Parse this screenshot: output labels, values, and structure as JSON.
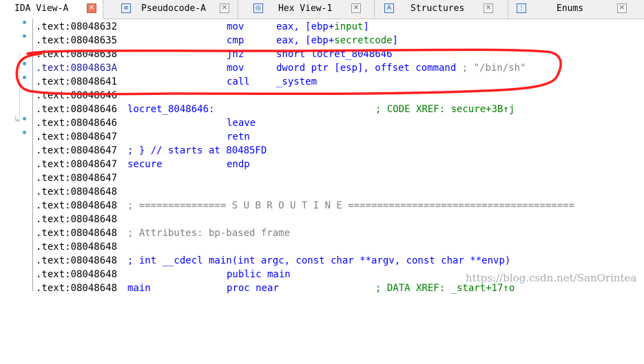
{
  "tabs": [
    {
      "label": "IDA View-A",
      "icon": "none",
      "active": true
    },
    {
      "label": "Pseudocode-A",
      "icon": "pseudocode-icon",
      "active": false
    },
    {
      "label": "Hex View-1",
      "icon": "hex-icon",
      "active": false
    },
    {
      "label": "Structures",
      "icon": "structures-icon",
      "active": false
    },
    {
      "label": "Enums",
      "icon": "enums-icon",
      "active": false
    }
  ],
  "tab_icons": {
    "pseudocode": "≡",
    "hex": "◎",
    "structures": "A",
    "enums": "⋮"
  },
  "close_glyph": "✕",
  "listing": [
    {
      "addr": ".text:08048632",
      "label": "",
      "mnem": "mov",
      "ops": "eax, [ebp+",
      "ops_green": "input",
      "ops_end": "]"
    },
    {
      "addr": ".text:08048635",
      "label": "",
      "mnem": "cmp",
      "ops": "eax, [ebp+",
      "ops_green": "secretcode",
      "ops_end": "]"
    },
    {
      "addr": ".text:08048638",
      "label": "",
      "mnem": "jnz",
      "ops": "short locret_8048646"
    },
    {
      "addr": ".text:0804863A",
      "label": "",
      "mnem": "mov",
      "ops": "dword ptr [esp], offset command",
      "comment": " ; \"/bin/sh\""
    },
    {
      "addr": ".text:08048641",
      "label": "",
      "mnem": "call",
      "ops": "_system"
    },
    {
      "addr": ".text:08048646",
      "label": ""
    },
    {
      "addr": ".text:08048646",
      "label": "locret_8048646:",
      "xref": "; CODE XREF: secure+3B↑j"
    },
    {
      "addr": ".text:08048646",
      "label": "",
      "mnem": "leave"
    },
    {
      "addr": ".text:08048647",
      "label": "",
      "mnem": "retn"
    },
    {
      "addr": ".text:08048647",
      "label": "; } // starts at 80485FD"
    },
    {
      "addr": ".text:08048647",
      "label": "secure",
      "mnem": "endp"
    },
    {
      "addr": ".text:08048647",
      "label": ""
    },
    {
      "addr": ".text:08048648",
      "label": ""
    },
    {
      "addr": ".text:08048648",
      "comment_line": "; =============== S U B R O U T I N E ======================================="
    },
    {
      "addr": ".text:08048648",
      "label": ""
    },
    {
      "addr": ".text:08048648",
      "comment_line": "; Attributes: bp-based frame"
    },
    {
      "addr": ".text:08048648",
      "label": ""
    },
    {
      "addr": ".text:08048648",
      "blue_line": "; int __cdecl main(int argc, const char **argv, const char **envp)"
    },
    {
      "addr": ".text:08048648",
      "label": "",
      "mnem": "public main"
    },
    {
      "addr": ".text:08048648",
      "label": "main",
      "mnem": "proc near",
      "xref": "; DATA XREF: _start+17↑o"
    }
  ],
  "watermark": "https://blog.csdn.net/SanOrintea",
  "colors": {
    "keyword_blue": "#0000ff",
    "xref_green": "#008000",
    "comment_gray": "#808080",
    "annotation_red": "#ff2020",
    "breakpoint_dot": "#45a3d8"
  }
}
